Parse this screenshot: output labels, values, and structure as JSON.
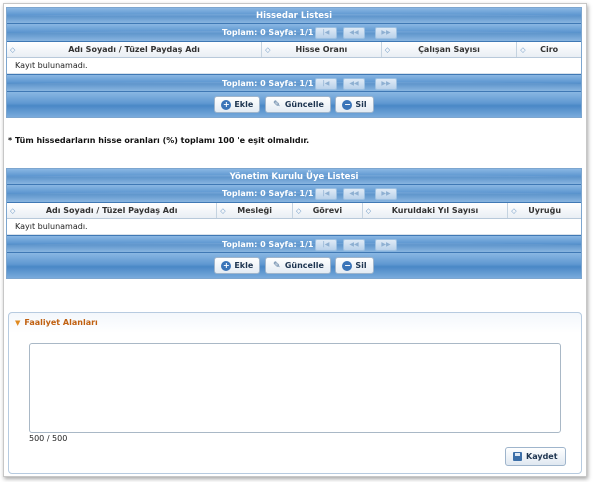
{
  "shareholders": {
    "title": "Hissedar Listesi",
    "pager_text": "Toplam: 0 Sayfa: 1/1",
    "pager_buttons": {
      "first": "|◀",
      "prev": "◀◀",
      "next": "▶▶"
    },
    "columns": [
      "Adı Soyadı / Tüzel Paydaş Adı",
      "Hisse Oranı",
      "Çalışan Sayısı",
      "Ciro"
    ],
    "empty_text": "Kayıt bulunamadı.",
    "buttons": {
      "add": "Ekle",
      "update": "Güncelle",
      "delete": "Sil"
    }
  },
  "note": "* Tüm hissedarların hisse oranları (%) toplamı 100 'e eşit olmalıdır.",
  "board": {
    "title": "Yönetim Kurulu Üye Listesi",
    "pager_text": "Toplam: 0 Sayfa: 1/1",
    "pager_buttons": {
      "first": "|◀",
      "prev": "◀◀",
      "next": "▶▶"
    },
    "columns": [
      "Adı Soyadı / Tüzel Paydaş Adı",
      "Mesleği",
      "Görevi",
      "Kuruldaki Yıl Sayısı",
      "Uyruğu"
    ],
    "empty_text": "Kayıt bulunamadı.",
    "buttons": {
      "add": "Ekle",
      "update": "Güncelle",
      "delete": "Sil"
    }
  },
  "activity": {
    "legend": "Faaliyet Alanları",
    "textarea_value": "",
    "counter": "500 / 500",
    "save_label": "Kaydet"
  },
  "colors": {
    "header_blue": "#5f98d1",
    "legend_orange": "#c06010"
  }
}
